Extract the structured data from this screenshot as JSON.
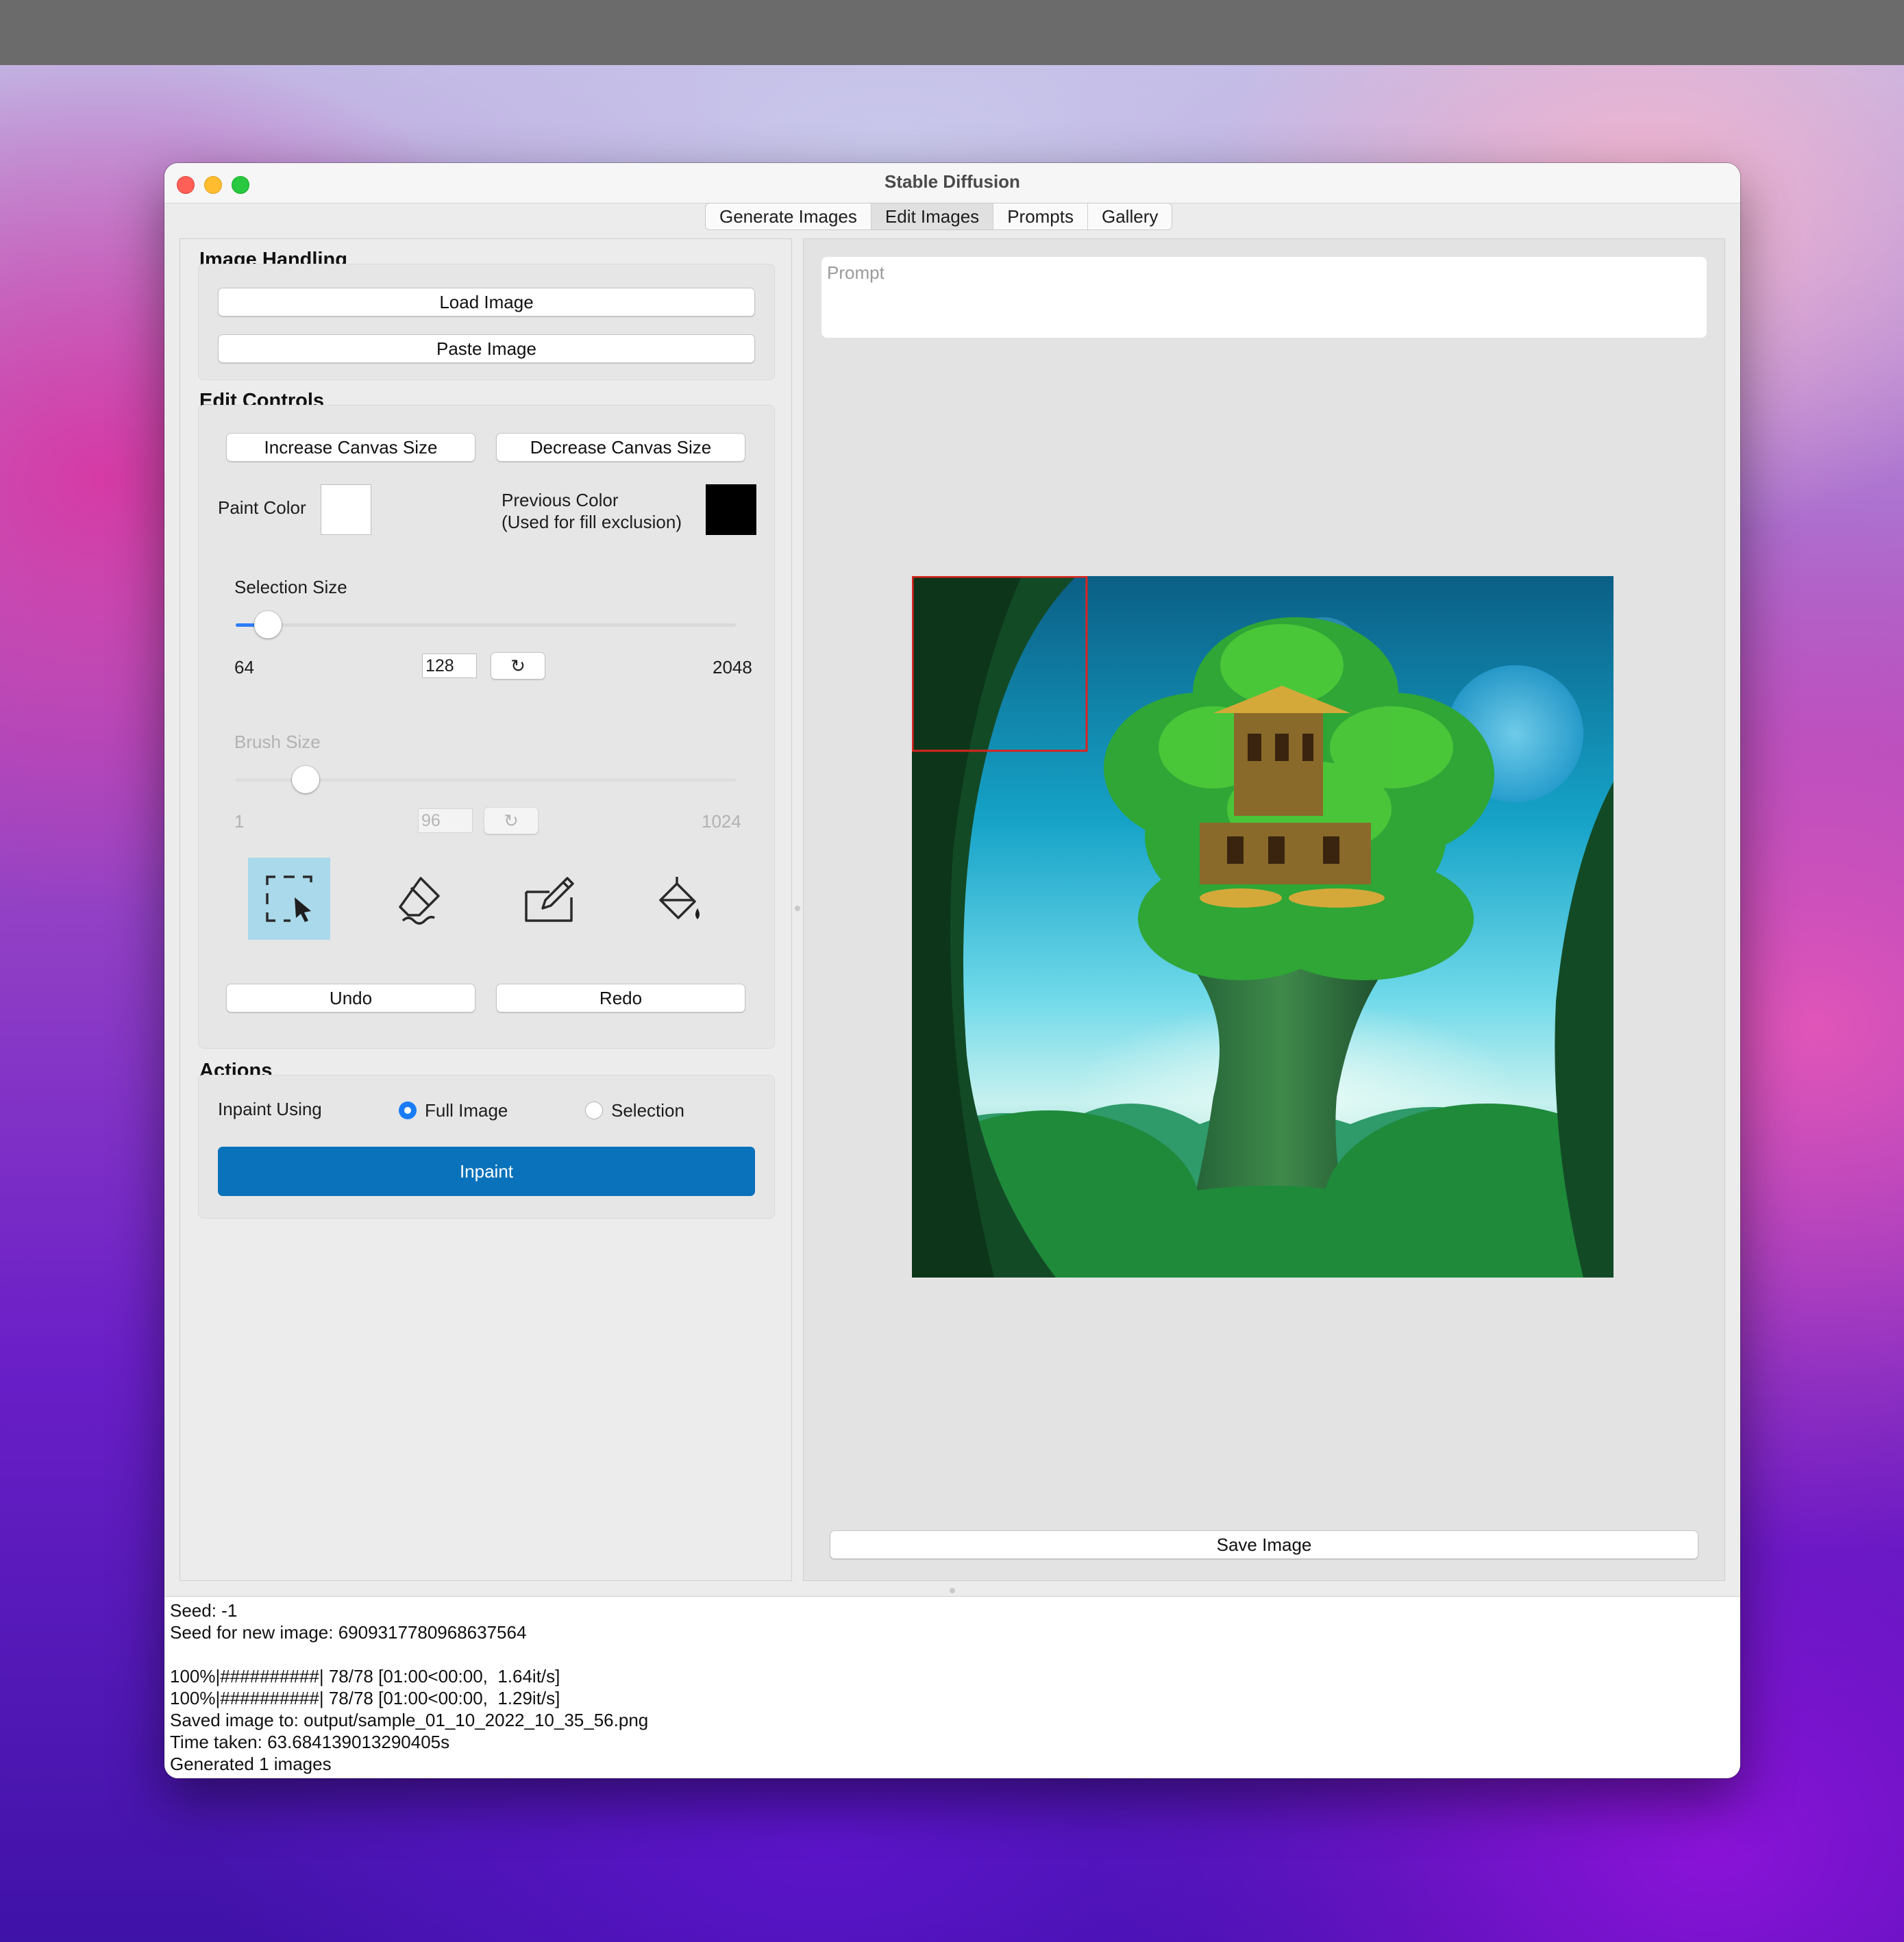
{
  "window": {
    "title": "Stable Diffusion"
  },
  "tabs": [
    "Generate Images",
    "Edit Images",
    "Prompts",
    "Gallery"
  ],
  "active_tab": "Edit Images",
  "image_handling": {
    "title": "Image Handling",
    "load_label": "Load Image",
    "paste_label": "Paste Image"
  },
  "edit_controls": {
    "title": "Edit Controls",
    "increase_label": "Increase Canvas Size",
    "decrease_label": "Decrease Canvas Size",
    "paint_color_label": "Paint Color",
    "paint_color": "#ffffff",
    "previous_color_line1": "Previous Color",
    "previous_color_line2": "(Used for fill exclusion)",
    "previous_color": "#000000",
    "selection_size": {
      "label": "Selection Size",
      "min": "64",
      "max": "2048",
      "value": "128",
      "fraction": 0.03
    },
    "brush_size": {
      "label": "Brush Size",
      "min": "1",
      "max": "1024",
      "value": "96",
      "fraction": 0.09
    },
    "reset_glyph": "↻",
    "tools": [
      "selection-tool-icon",
      "eraser-tool-icon",
      "pencil-tool-icon",
      "fill-bucket-icon"
    ],
    "undo_label": "Undo",
    "redo_label": "Redo"
  },
  "actions": {
    "title": "Actions",
    "inpaint_using_label": "Inpaint Using",
    "option_full": "Full Image",
    "option_selection": "Selection",
    "selected": "Full Image",
    "inpaint_label": "Inpaint"
  },
  "canvas": {
    "prompt_placeholder": "Prompt",
    "save_label": "Save Image",
    "selection_box_color": "#d8241f"
  },
  "log": [
    "Seed: -1",
    "Seed for new image: 6909317780968637564",
    "",
    "100%|##########| 78/78 [01:00<00:00,  1.64it/s]",
    "100%|##########| 78/78 [01:00<00:00,  1.29it/s]",
    "Saved image to: output/sample_01_10_2022_10_35_56.png",
    "Time taken: 63.684139013290405s",
    "Generated 1 images"
  ],
  "colors": {
    "accent": "#0a72ba",
    "tool_active": "#a9d9ea",
    "slider": "#2e7cf6"
  }
}
